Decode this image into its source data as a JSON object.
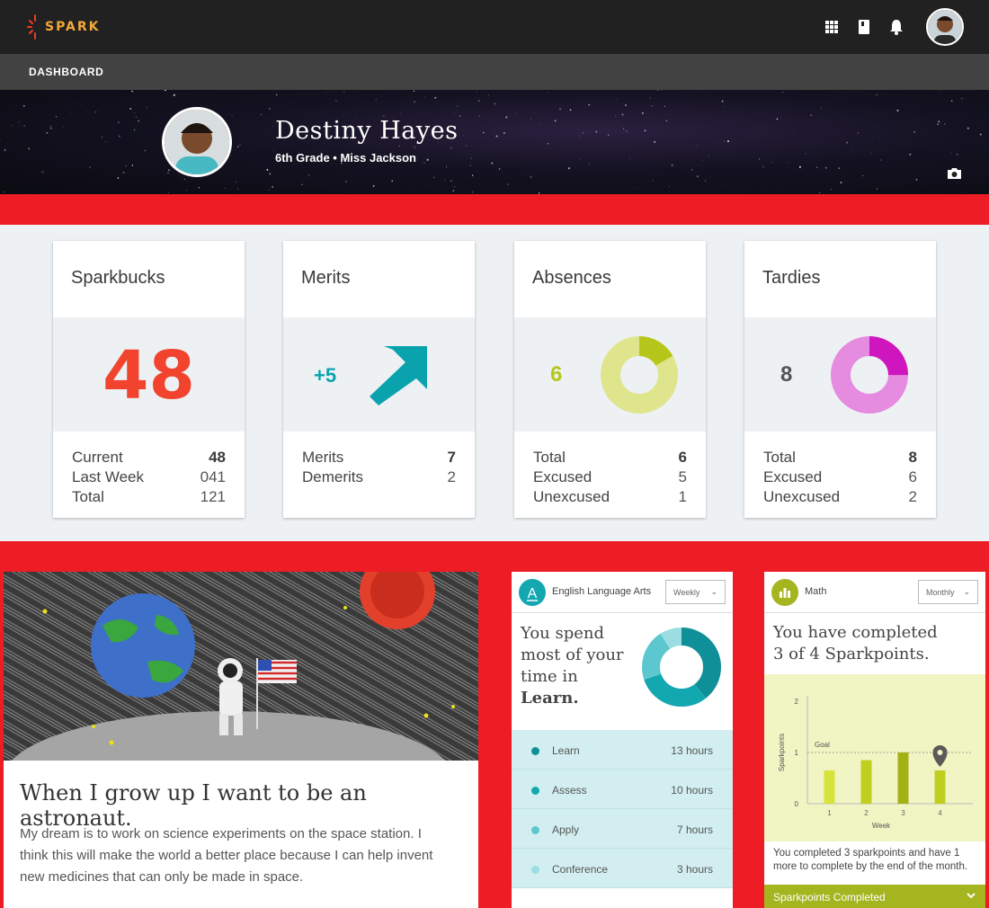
{
  "app": {
    "logo_text": "SPARK"
  },
  "topbar": {
    "icons": [
      "apps-grid-icon",
      "book-icon",
      "bell-icon"
    ]
  },
  "subbar": {
    "title": "DASHBOARD"
  },
  "profile": {
    "name": "Destiny Hayes",
    "subtitle": "6th Grade • Miss Jackson"
  },
  "cards": {
    "sparkbucks": {
      "title": "Sparkbucks",
      "value": "48",
      "rows": [
        {
          "label": "Current",
          "value": "48"
        },
        {
          "label": "Last Week",
          "value": "041"
        },
        {
          "label": "Total",
          "value": "121"
        }
      ]
    },
    "merits": {
      "title": "Merits",
      "delta": "+5",
      "rows": [
        {
          "label": "Merits",
          "value": "7"
        },
        {
          "label": "Demerits",
          "value": "2"
        }
      ]
    },
    "absences": {
      "title": "Absences",
      "value": "6",
      "fraction_unexcused": 0.167,
      "rows": [
        {
          "label": "Total",
          "value": "6"
        },
        {
          "label": "Excused",
          "value": "5"
        },
        {
          "label": "Unexcused",
          "value": "1"
        }
      ]
    },
    "tardies": {
      "title": "Tardies",
      "value": "8",
      "fraction_unexcused": 0.25,
      "rows": [
        {
          "label": "Total",
          "value": "8"
        },
        {
          "label": "Excused",
          "value": "6"
        },
        {
          "label": "Unexcused",
          "value": "2"
        }
      ]
    }
  },
  "essay": {
    "title": "When I grow up I want to be an astronaut.",
    "body": "My dream is to work on science experiments on the space station. I think this will make the world a better place because I can help invent new medicines that can only be made in space."
  },
  "ela": {
    "subject": "English Language Arts",
    "period": "Weekly",
    "line1": "You spend",
    "line2": "most of your",
    "line3": "time in",
    "highlight": "Learn.",
    "items": [
      {
        "label": "Learn",
        "hours": "13 hours",
        "value": 13,
        "color": "#0f8f97"
      },
      {
        "label": "Assess",
        "hours": "10 hours",
        "value": 10,
        "color": "#13a7b0"
      },
      {
        "label": "Apply",
        "hours": "7 hours",
        "value": 7,
        "color": "#5cc7cf"
      },
      {
        "label": "Conference",
        "hours": "3 hours",
        "value": 3,
        "color": "#9bdde2"
      }
    ]
  },
  "math": {
    "subject": "Math",
    "period": "Monthly",
    "line1": "You have completed",
    "line2": "3 of 4 Sparkpoints.",
    "note": "You completed 3 sparkpoints and have 1 more to complete by the end of the month.",
    "footer": "Sparkpoints Completed"
  },
  "chart_data": {
    "type": "bar",
    "xlabel": "Week",
    "ylabel": "Sparkpoints",
    "categories": [
      "1",
      "2",
      "3",
      "4"
    ],
    "values": [
      0.65,
      0.85,
      1.0,
      0.65
    ],
    "ylim": [
      0,
      2
    ],
    "yticks": [
      "0",
      "1",
      "2"
    ],
    "goal_value": 1,
    "goal_label": "Goal",
    "bar_colors": [
      "#d6e33a",
      "#c0cf1f",
      "#a2b114",
      "#c0cf1f"
    ],
    "marker_category": "4"
  }
}
